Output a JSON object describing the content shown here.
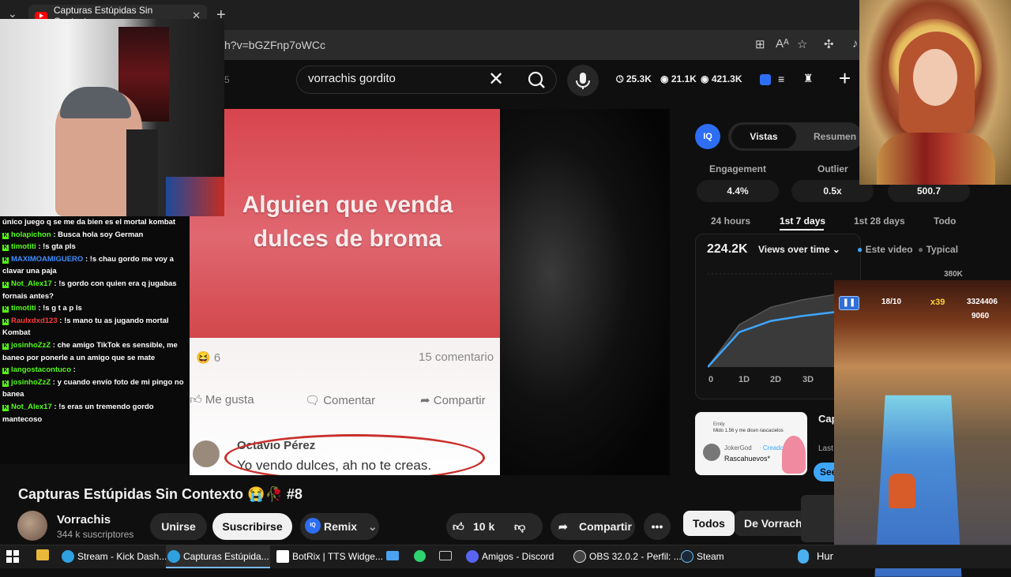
{
  "browser": {
    "tab_title": "Capturas Estúpidas Sin Contexto",
    "url": "h?v=bGZFnp7oWCc",
    "icons": [
      "chevron-down-icon",
      "youtube-icon",
      "close-icon",
      "plus-icon",
      "apps-icon",
      "read-aloud-icon",
      "favorite-icon",
      "extensions-icon"
    ]
  },
  "youtube": {
    "search_query": "vorrachis gordito",
    "partial_badge": "5",
    "stats": {
      "likes_stat": "25.3K",
      "views_stat": "21.1K",
      "total_stat": "421.3K"
    }
  },
  "video": {
    "meme_text": "Alguien que venda dulces de broma",
    "reactions_count": "6",
    "comments_count": "15 comentario",
    "fb_like": "Me gusta",
    "fb_comment": "Comentar",
    "fb_share": "Compartir",
    "commenter_name": "Octavio Pérez",
    "commenter_text": "Yo vendo dulces, ah no te creas."
  },
  "chat": [
    {
      "user": "",
      "text": "único juego q se me da bien es el mortal kombat",
      "color": "#ffffff"
    },
    {
      "user": "holapichon",
      "text": ": Busca hola soy German",
      "color": "#53fc18"
    },
    {
      "user": "timotiti",
      "text": ": !s gta pls",
      "color": "#53fc18"
    },
    {
      "user": "MAXIMOAMIGUERO",
      "text": ": !s chau gordo me voy a clavar una paja",
      "color": "#3e8fff"
    },
    {
      "user": "Not_Alex17",
      "text": ": !s gordo con quien era q jugabas fornais antes?",
      "color": "#53fc18"
    },
    {
      "user": "timotiti",
      "text": ": !s g t a p ls",
      "color": "#53fc18"
    },
    {
      "user": "Raulxdxd123",
      "text": ": !s mano tu as jugando mortal Kombat",
      "color": "#ff3b3b"
    },
    {
      "user": "josinhoZzZ",
      "text": ": che amigo TikTok es sensible, me baneo por ponerle a un amigo que se mate",
      "color": "#53fc18"
    },
    {
      "user": "langostacontuco",
      "text": ":",
      "color": "#53fc18"
    },
    {
      "user": "josinhoZzZ",
      "text": ": y cuando envío foto de mi pingo no banea",
      "color": "#53fc18"
    },
    {
      "user": "Not_Alex17",
      "text": ": !s eras un tremendo gordo mantecoso",
      "color": "#53fc18"
    }
  ],
  "panel": {
    "iq_label": "IQ",
    "tab_active": "Vistas",
    "tab_other": "Resumen",
    "metric_labels": [
      "Engagement",
      "Outlier",
      ""
    ],
    "metric_values": [
      "4.4%",
      "0.5x",
      "500.7"
    ],
    "ranges": [
      "24 hours",
      "1st 7 days",
      "1st 28 days",
      "Todo"
    ],
    "views_total": "224.2K",
    "views_selector": "Views over time",
    "legend": [
      "Este video",
      "Typical"
    ],
    "y_max_label": "380K",
    "x_labels": [
      "0",
      "1D",
      "2D",
      "3D"
    ]
  },
  "chart_data": {
    "type": "line",
    "title": "Views over time",
    "y_ticks": [
      "380K"
    ],
    "x": [
      "0",
      "1D",
      "2D",
      "3D"
    ],
    "series": [
      {
        "name": "Este video",
        "values": [
          0,
          140000,
          185000,
          205000,
          220000
        ]
      },
      {
        "name": "Typical",
        "values": [
          0,
          170000,
          240000,
          270000,
          290000
        ]
      }
    ],
    "accent": "#3ea6ff"
  },
  "short_card": {
    "user1": "Emily",
    "msg1": "Mido 1.56 y me dicen rascacielos",
    "user2": "JokerGod",
    "role": "· Creador",
    "msg2": "Rascahuevos*",
    "side_title": "Cap Cor",
    "side_meta": "Last",
    "see_label": "See"
  },
  "info": {
    "title": "Capturas Estúpidas Sin Contexto 😭🥀 #8",
    "channel": "Vorrachis",
    "subscribers": "344 k suscriptores",
    "join": "Unirse",
    "subscribe": "Suscribirse",
    "remix": "Remix",
    "likes": "10 k",
    "share": "Compartir",
    "chip_all": "Todos",
    "chip_channel": "De Vorrachis"
  },
  "game": {
    "level": "18/10",
    "multiplier": "x39",
    "score": "3324406",
    "coins": "9060"
  },
  "taskbar": {
    "items": [
      "Stream - Kick Dash...",
      "Capturas Estúpida...",
      "BotRix | TTS Widge...",
      "Amigos - Discord",
      "OBS 32.0.2 - Perfil: ...",
      "Steam"
    ],
    "tray_text": "Hur"
  }
}
